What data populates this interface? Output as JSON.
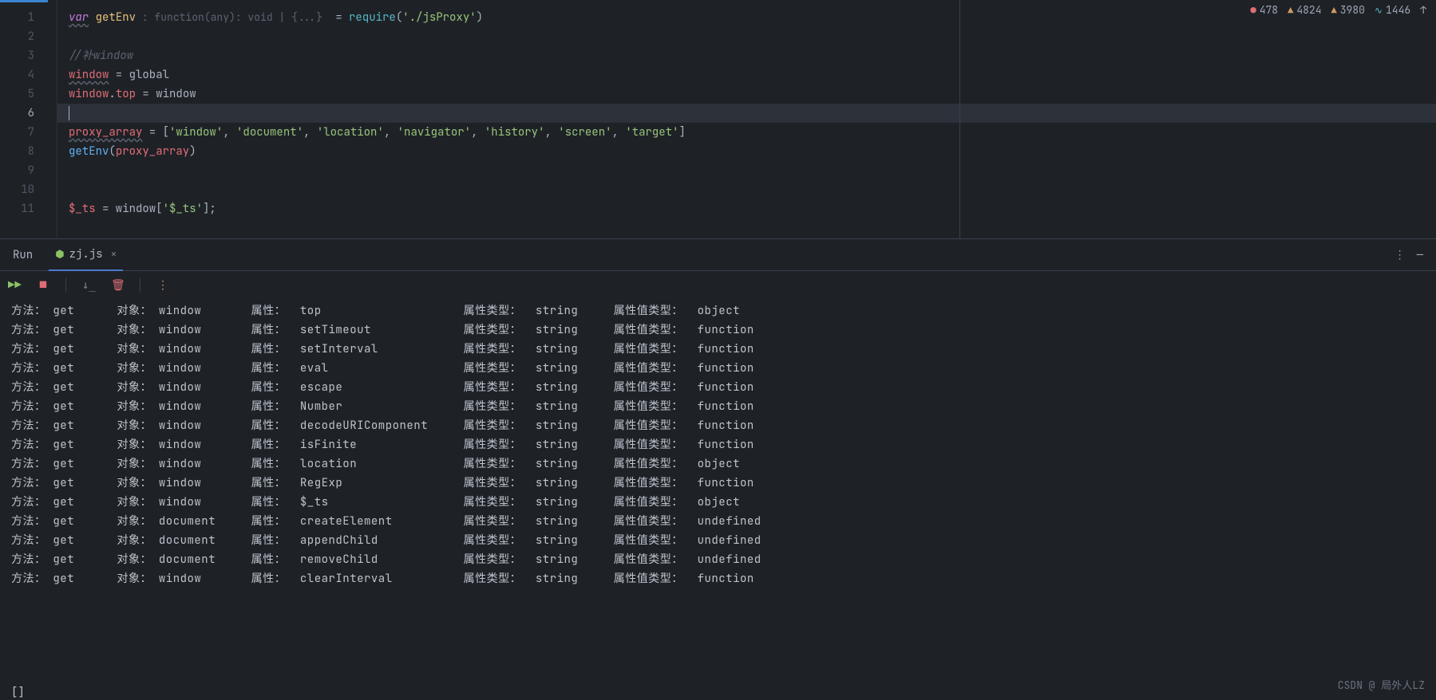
{
  "status": {
    "errors": "478",
    "warnings1": "4824",
    "warnings2": "3980",
    "weak": "1446"
  },
  "editor": {
    "lines": [
      "1",
      "2",
      "3",
      "4",
      "5",
      "6",
      "7",
      "8",
      "9",
      "10",
      "11"
    ]
  },
  "code": {
    "l1_var": "var",
    "l1_name": "getEnv",
    "l1_hint": " : function(any): void | {...} ",
    "l1_eq": " = ",
    "l1_req": "require",
    "l1_paren_o": "(",
    "l1_str": "'./jsProxy'",
    "l1_paren_c": ")",
    "l3_comment": "//补window",
    "l4_win": "window",
    "l4_rest": " = global",
    "l5_win": "window",
    "l5_dot": ".",
    "l5_top": "top",
    "l5_rest": " = window",
    "l7_proxy": "proxy_array",
    "l7_eq": " = [",
    "l7_s1": "'window'",
    "l7_s2": "'document'",
    "l7_s3": "'location'",
    "l7_s4": "'navigator'",
    "l7_s5": "'history'",
    "l7_s6": "'screen'",
    "l7_s7": "'target'",
    "l7_close": "]",
    "l8_fn": "getEnv",
    "l8_po": "(",
    "l8_arg": "proxy_array",
    "l8_pc": ")",
    "l11_ts": "$_ts",
    "l11_rest": " = window[",
    "l11_str": "'$_ts'",
    "l11_end": "];"
  },
  "run": {
    "label": "Run",
    "tab_name": "zj.js",
    "close": "×"
  },
  "console_rows": [
    {
      "method": "get",
      "obj": "window",
      "prop": "top",
      "ptype": "string",
      "vtype": "object"
    },
    {
      "method": "get",
      "obj": "window",
      "prop": "setTimeout",
      "ptype": "string",
      "vtype": "function"
    },
    {
      "method": "get",
      "obj": "window",
      "prop": "setInterval",
      "ptype": "string",
      "vtype": "function"
    },
    {
      "method": "get",
      "obj": "window",
      "prop": "eval",
      "ptype": "string",
      "vtype": "function"
    },
    {
      "method": "get",
      "obj": "window",
      "prop": "escape",
      "ptype": "string",
      "vtype": "function"
    },
    {
      "method": "get",
      "obj": "window",
      "prop": "Number",
      "ptype": "string",
      "vtype": "function"
    },
    {
      "method": "get",
      "obj": "window",
      "prop": "decodeURIComponent",
      "ptype": "string",
      "vtype": "function"
    },
    {
      "method": "get",
      "obj": "window",
      "prop": "isFinite",
      "ptype": "string",
      "vtype": "function"
    },
    {
      "method": "get",
      "obj": "window",
      "prop": "location",
      "ptype": "string",
      "vtype": "object"
    },
    {
      "method": "get",
      "obj": "window",
      "prop": "RegExp",
      "ptype": "string",
      "vtype": "function"
    },
    {
      "method": "get",
      "obj": "window",
      "prop": "$_ts",
      "ptype": "string",
      "vtype": "object"
    },
    {
      "method": "get",
      "obj": "document",
      "prop": "createElement",
      "ptype": "string",
      "vtype": "undefined"
    },
    {
      "method": "get",
      "obj": "document",
      "prop": "appendChild",
      "ptype": "string",
      "vtype": "undefined"
    },
    {
      "method": "get",
      "obj": "document",
      "prop": "removeChild",
      "ptype": "string",
      "vtype": "undefined"
    },
    {
      "method": "get",
      "obj": "window",
      "prop": "clearInterval",
      "ptype": "string",
      "vtype": "function"
    }
  ],
  "labels": {
    "method": "方法：",
    "obj": "对象：",
    "prop": "属性：",
    "ptype": "属性类型：",
    "vtype": "属性值类型："
  },
  "watermark": "CSDN @ 局外人LZ"
}
